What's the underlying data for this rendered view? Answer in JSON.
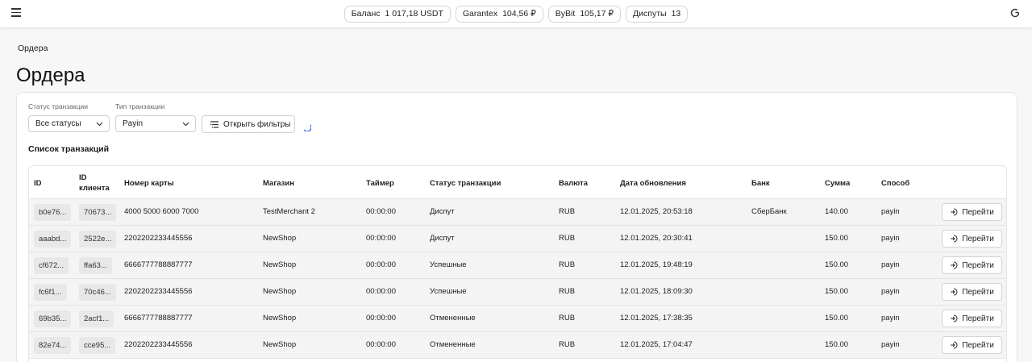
{
  "topbar": {
    "chips": [
      {
        "label": "Баланс",
        "value": "1 017,18 USDT"
      },
      {
        "label": "Garantex",
        "value": "104,56 ₽"
      },
      {
        "label": "ByBit",
        "value": "105,17 ₽"
      },
      {
        "label": "Диспуты",
        "value": "13"
      }
    ]
  },
  "breadcrumb": "Ордера",
  "title": "Ордера",
  "filters": {
    "status_label": "Статус транзакции",
    "status_value": "Все статусы",
    "type_label": "Тип транзакции",
    "type_value": "Payin",
    "open_filters": "Открыть фильтры"
  },
  "list_title": "Список транзакций",
  "columns": {
    "id": "ID",
    "client_id_1": "ID",
    "client_id_2": "клиента",
    "card": "Номер карты",
    "shop": "Магазин",
    "timer": "Таймер",
    "status": "Статус транзакции",
    "currency": "Валюта",
    "updated": "Дата обновления",
    "bank": "Банк",
    "amount": "Сумма",
    "method": "Способ"
  },
  "go_label": "Перейти",
  "rows": [
    {
      "id": "b0e76...",
      "client": "70673...",
      "card": "4000 5000 6000 7000",
      "shop": "TestMerchant 2",
      "timer": "00:00:00",
      "status": "Диспут",
      "currency": "RUB",
      "updated": "12.01.2025, 20:53:18",
      "bank": "СберБанк",
      "amount": "140.00",
      "method": "payin"
    },
    {
      "id": "aaabd...",
      "client": "2522e...",
      "card": "2202202233445556",
      "shop": "NewShop",
      "timer": "00:00:00",
      "status": "Диспут",
      "currency": "RUB",
      "updated": "12.01.2025, 20:30:41",
      "bank": "",
      "amount": "150.00",
      "method": "payin"
    },
    {
      "id": "cf672...",
      "client": "ffa63...",
      "card": "6666777788887777",
      "shop": "NewShop",
      "timer": "00:00:00",
      "status": "Успешные",
      "currency": "RUB",
      "updated": "12.01.2025, 19:48:19",
      "bank": "",
      "amount": "150.00",
      "method": "payin"
    },
    {
      "id": "fc6f1...",
      "client": "70c46...",
      "card": "2202202233445556",
      "shop": "NewShop",
      "timer": "00:00:00",
      "status": "Успешные",
      "currency": "RUB",
      "updated": "12.01.2025, 18:09:30",
      "bank": "",
      "amount": "150.00",
      "method": "payin"
    },
    {
      "id": "69b35...",
      "client": "2acf1...",
      "card": "6666777788887777",
      "shop": "NewShop",
      "timer": "00:00:00",
      "status": "Отмененные",
      "currency": "RUB",
      "updated": "12.01.2025, 17:38:35",
      "bank": "",
      "amount": "150.00",
      "method": "payin"
    },
    {
      "id": "82e74...",
      "client": "cce95...",
      "card": "2202202233445556",
      "shop": "NewShop",
      "timer": "00:00:00",
      "status": "Отмененные",
      "currency": "RUB",
      "updated": "12.01.2025, 17:04:47",
      "bank": "",
      "amount": "150.00",
      "method": "payin"
    }
  ]
}
